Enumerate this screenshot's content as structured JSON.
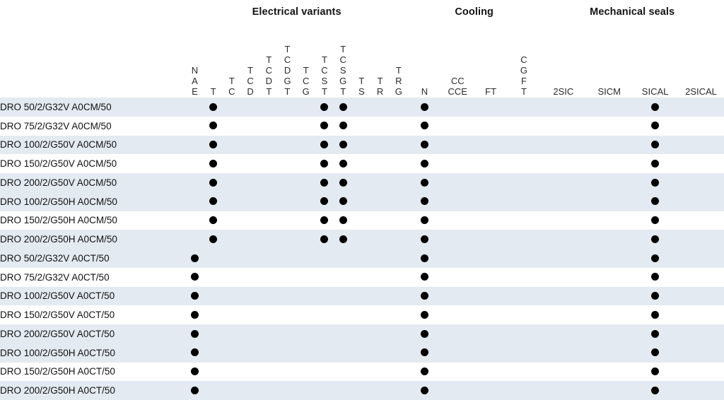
{
  "table": {
    "groups": [
      {
        "id": "electrical",
        "label": "Electrical variants",
        "span": 12
      },
      {
        "id": "cooling",
        "label": "Cooling",
        "span": 4
      },
      {
        "id": "seals",
        "label": "Mechanical seals",
        "span": 4
      }
    ],
    "columns": [
      {
        "key": "NAE",
        "group": "electrical",
        "lines": [
          "N",
          "A",
          "E"
        ]
      },
      {
        "key": "T",
        "group": "electrical",
        "lines": [
          "T"
        ]
      },
      {
        "key": "TC",
        "group": "electrical",
        "lines": [
          "T",
          "C"
        ]
      },
      {
        "key": "TCD",
        "group": "electrical",
        "lines": [
          "T",
          "C",
          "D"
        ]
      },
      {
        "key": "TCDT",
        "group": "electrical",
        "lines": [
          "T",
          "C",
          "D",
          "T"
        ]
      },
      {
        "key": "TCDGT",
        "group": "electrical",
        "lines": [
          "T",
          "C",
          "D",
          "G",
          "T"
        ]
      },
      {
        "key": "TCG",
        "group": "electrical",
        "lines": [
          "T",
          "C",
          "G"
        ]
      },
      {
        "key": "TCST",
        "group": "electrical",
        "lines": [
          "T",
          "C",
          "S",
          "T"
        ]
      },
      {
        "key": "TCSGT",
        "group": "electrical",
        "lines": [
          "T",
          "C",
          "S",
          "G",
          "T"
        ]
      },
      {
        "key": "TS",
        "group": "electrical",
        "lines": [
          "T",
          "S"
        ]
      },
      {
        "key": "TR",
        "group": "electrical",
        "lines": [
          "T",
          "R"
        ]
      },
      {
        "key": "TRG",
        "group": "electrical",
        "lines": [
          "T",
          "R",
          "G"
        ]
      },
      {
        "key": "N",
        "group": "cooling",
        "lines": [
          "N"
        ]
      },
      {
        "key": "CCCCE",
        "group": "cooling",
        "lines": [
          "CC",
          "CCE"
        ]
      },
      {
        "key": "FT",
        "group": "cooling",
        "lines": [
          "FT"
        ]
      },
      {
        "key": "CGFT",
        "group": "cooling",
        "lines": [
          "C",
          "G",
          "F",
          "T"
        ]
      },
      {
        "key": "2SIC",
        "group": "seals",
        "lines": [
          "2SIC"
        ]
      },
      {
        "key": "SICM",
        "group": "seals",
        "lines": [
          "SICM"
        ]
      },
      {
        "key": "SICAL",
        "group": "seals",
        "lines": [
          "SICAL"
        ]
      },
      {
        "key": "2SICAL",
        "group": "seals",
        "lines": [
          "2SICAL"
        ]
      }
    ],
    "rows": [
      {
        "label": "DRO 50/2/G32V A0CM/50",
        "block": 0,
        "marks": [
          0,
          1,
          0,
          0,
          0,
          0,
          0,
          1,
          1,
          0,
          0,
          0,
          1,
          0,
          0,
          0,
          0,
          0,
          1,
          0
        ]
      },
      {
        "label": "DRO 75/2/G32V A0CM/50",
        "block": 0,
        "marks": [
          0,
          1,
          0,
          0,
          0,
          0,
          0,
          1,
          1,
          0,
          0,
          0,
          1,
          0,
          0,
          0,
          0,
          0,
          1,
          0
        ]
      },
      {
        "label": "DRO 100/2/G50V A0CM/50",
        "block": 1,
        "marks": [
          0,
          1,
          0,
          0,
          0,
          0,
          0,
          1,
          1,
          0,
          0,
          0,
          1,
          0,
          0,
          0,
          0,
          0,
          1,
          0
        ]
      },
      {
        "label": "DRO 150/2/G50V A0CM/50",
        "block": 1,
        "marks": [
          0,
          1,
          0,
          0,
          0,
          0,
          0,
          1,
          1,
          0,
          0,
          0,
          1,
          0,
          0,
          0,
          0,
          0,
          1,
          0
        ]
      },
      {
        "label": "DRO 200/2/G50V A0CM/50",
        "block": 1,
        "marks": [
          0,
          1,
          0,
          0,
          0,
          0,
          0,
          1,
          1,
          0,
          0,
          0,
          1,
          0,
          0,
          0,
          0,
          0,
          1,
          0
        ]
      },
      {
        "label": "DRO 100/2/G50H A0CM/50",
        "block": 2,
        "marks": [
          0,
          1,
          0,
          0,
          0,
          0,
          0,
          1,
          1,
          0,
          0,
          0,
          1,
          0,
          0,
          0,
          0,
          0,
          1,
          0
        ]
      },
      {
        "label": "DRO 150/2/G50H A0CM/50",
        "block": 2,
        "marks": [
          0,
          1,
          0,
          0,
          0,
          0,
          0,
          1,
          1,
          0,
          0,
          0,
          1,
          0,
          0,
          0,
          0,
          0,
          1,
          0
        ]
      },
      {
        "label": "DRO 200/2/G50H A0CM/50",
        "block": 2,
        "marks": [
          0,
          1,
          0,
          0,
          0,
          0,
          0,
          1,
          1,
          0,
          0,
          0,
          1,
          0,
          0,
          0,
          0,
          0,
          1,
          0
        ]
      },
      {
        "label": "DRO 50/2/G32V A0CT/50",
        "block": 3,
        "marks": [
          1,
          0,
          0,
          0,
          0,
          0,
          0,
          0,
          0,
          0,
          0,
          0,
          1,
          0,
          0,
          0,
          0,
          0,
          1,
          0
        ]
      },
      {
        "label": "DRO 75/2/G32V A0CT/50",
        "block": 3,
        "marks": [
          1,
          0,
          0,
          0,
          0,
          0,
          0,
          0,
          0,
          0,
          0,
          0,
          1,
          0,
          0,
          0,
          0,
          0,
          1,
          0
        ]
      },
      {
        "label": "DRO 100/2/G50V A0CT/50",
        "block": 4,
        "marks": [
          1,
          0,
          0,
          0,
          0,
          0,
          0,
          0,
          0,
          0,
          0,
          0,
          1,
          0,
          0,
          0,
          0,
          0,
          1,
          0
        ]
      },
      {
        "label": "DRO 150/2/G50V A0CT/50",
        "block": 4,
        "marks": [
          1,
          0,
          0,
          0,
          0,
          0,
          0,
          0,
          0,
          0,
          0,
          0,
          1,
          0,
          0,
          0,
          0,
          0,
          1,
          0
        ]
      },
      {
        "label": "DRO 200/2/G50V A0CT/50",
        "block": 4,
        "marks": [
          1,
          0,
          0,
          0,
          0,
          0,
          0,
          0,
          0,
          0,
          0,
          0,
          1,
          0,
          0,
          0,
          0,
          0,
          1,
          0
        ]
      },
      {
        "label": "DRO 100/2/G50H A0CT/50",
        "block": 5,
        "marks": [
          1,
          0,
          0,
          0,
          0,
          0,
          0,
          0,
          0,
          0,
          0,
          0,
          1,
          0,
          0,
          0,
          0,
          0,
          1,
          0
        ]
      },
      {
        "label": "DRO 150/2/G50H A0CT/50",
        "block": 5,
        "marks": [
          1,
          0,
          0,
          0,
          0,
          0,
          0,
          0,
          0,
          0,
          0,
          0,
          1,
          0,
          0,
          0,
          0,
          0,
          1,
          0
        ]
      },
      {
        "label": "DRO 200/2/G50H A0CT/50",
        "block": 5,
        "marks": [
          1,
          0,
          0,
          0,
          0,
          0,
          0,
          0,
          0,
          0,
          0,
          0,
          1,
          0,
          0,
          0,
          0,
          0,
          1,
          0
        ]
      }
    ],
    "mark_glyph": "dot",
    "colors": {
      "band_shade": "#e3eaf1",
      "band_plain": "#ffffff",
      "border_strong": "#9fb8ca",
      "border_light": "#b9cddc",
      "mark": "#000000"
    },
    "label_column_width": 262
  }
}
